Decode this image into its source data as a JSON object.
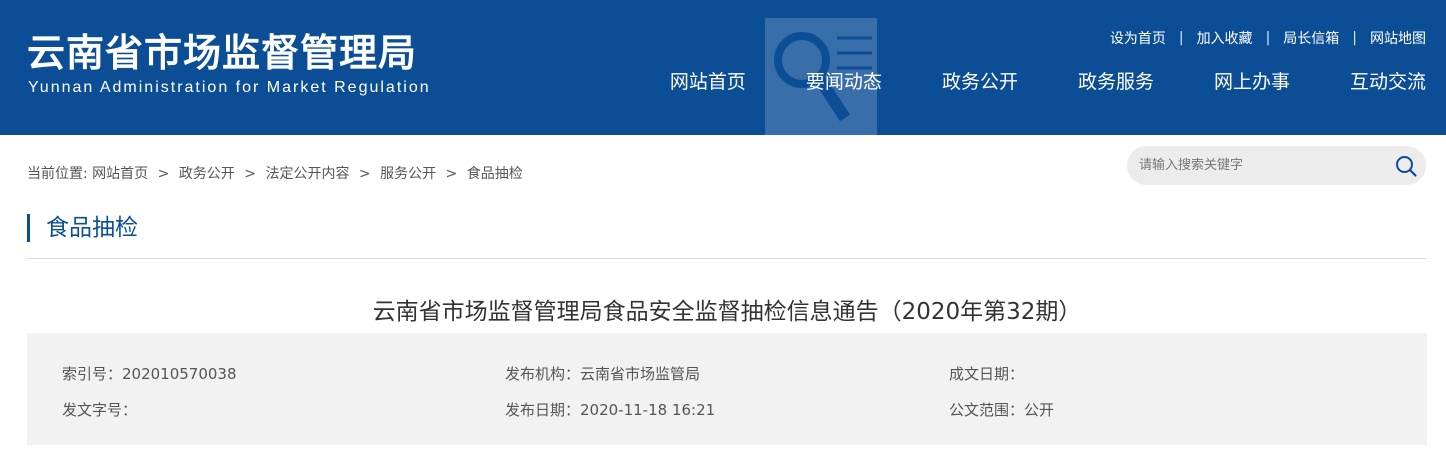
{
  "header": {
    "logo_cn": "云南省市场监督管理局",
    "logo_en": "Yunnan Administration for Market Regulation",
    "background_color": "#0c4e96",
    "toplinks": [
      "设为首页",
      "加入收藏",
      "局长信箱",
      "网站地图"
    ],
    "toplink_separator": "|",
    "nav": [
      "网站首页",
      "要闻动态",
      "政务公开",
      "政务服务",
      "网上办事",
      "互动交流"
    ]
  },
  "breadcrumb": {
    "prefix": "当前位置:",
    "items": [
      "网站首页",
      "政务公开",
      "法定公开内容",
      "服务公开",
      "食品抽检"
    ],
    "separator": ">"
  },
  "search": {
    "placeholder": "请输入搜索关键字",
    "icon": "search-icon"
  },
  "section": {
    "title": "食品抽检"
  },
  "article": {
    "title": "云南省市场监督管理局食品安全监督抽检信息通告（2020年第32期）",
    "meta": {
      "index_no": "索引号：202010570038",
      "publisher": "发布机构：云南省市场监管局",
      "doc_date": "成文日期：",
      "doc_no": "发文字号：",
      "publish_date": "发布日期：2020-11-18 16:21",
      "scope": "公文范围：公开"
    }
  }
}
